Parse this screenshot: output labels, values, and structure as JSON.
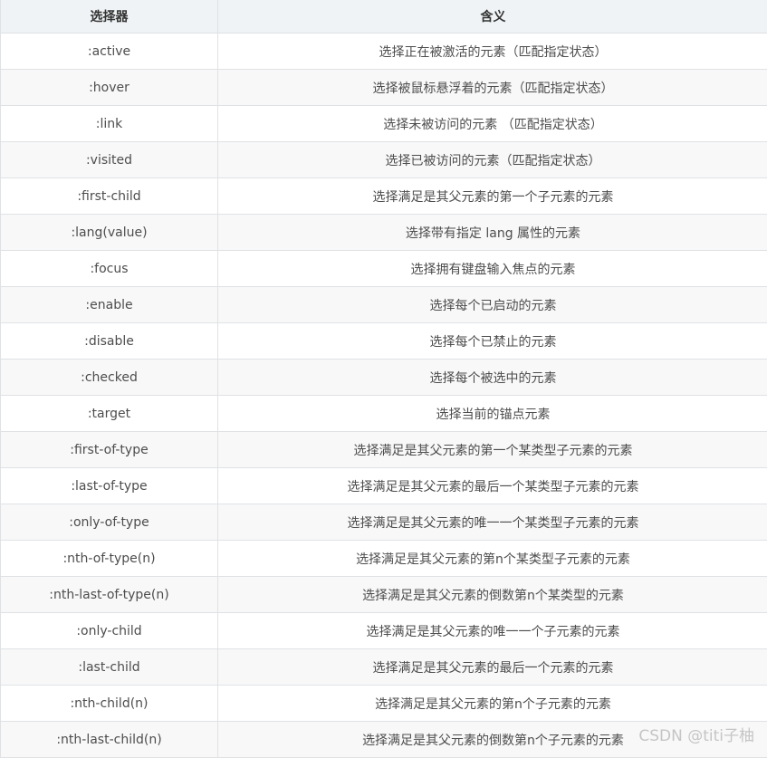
{
  "table": {
    "headers": [
      "选择器",
      "含义"
    ],
    "rows": [
      {
        "selector": ":active",
        "meaning": "选择正在被激活的元素（匹配指定状态）"
      },
      {
        "selector": ":hover",
        "meaning": "选择被鼠标悬浮着的元素（匹配指定状态）"
      },
      {
        "selector": ":link",
        "meaning": "选择未被访问的元素 （匹配指定状态）"
      },
      {
        "selector": ":visited",
        "meaning": "选择已被访问的元素（匹配指定状态）"
      },
      {
        "selector": ":first-child",
        "meaning": "选择满足是其父元素的第一个子元素的元素"
      },
      {
        "selector": ":lang(value)",
        "meaning": "选择带有指定 lang 属性的元素"
      },
      {
        "selector": ":focus",
        "meaning": "选择拥有键盘输入焦点的元素"
      },
      {
        "selector": ":enable",
        "meaning": "选择每个已启动的元素"
      },
      {
        "selector": ":disable",
        "meaning": "选择每个已禁止的元素"
      },
      {
        "selector": ":checked",
        "meaning": "选择每个被选中的元素"
      },
      {
        "selector": ":target",
        "meaning": "选择当前的锚点元素"
      },
      {
        "selector": ":first-of-type",
        "meaning": "选择满足是其父元素的第一个某类型子元素的元素"
      },
      {
        "selector": ":last-of-type",
        "meaning": "选择满足是其父元素的最后一个某类型子元素的元素"
      },
      {
        "selector": ":only-of-type",
        "meaning": "选择满足是其父元素的唯一一个某类型子元素的元素"
      },
      {
        "selector": ":nth-of-type(n)",
        "meaning": "选择满足是其父元素的第n个某类型子元素的元素"
      },
      {
        "selector": ":nth-last-of-type(n)",
        "meaning": "选择满足是其父元素的倒数第n个某类型的元素"
      },
      {
        "selector": ":only-child",
        "meaning": "选择满足是其父元素的唯一一个子元素的元素"
      },
      {
        "selector": ":last-child",
        "meaning": "选择满足是其父元素的最后一个元素的元素"
      },
      {
        "selector": ":nth-child(n)",
        "meaning": "选择满足是其父元素的第n个子元素的元素"
      },
      {
        "selector": ":nth-last-child(n)",
        "meaning": "选择满足是其父元素的倒数第n个子元素的元素"
      }
    ]
  },
  "watermark": "CSDN @titi子柚"
}
